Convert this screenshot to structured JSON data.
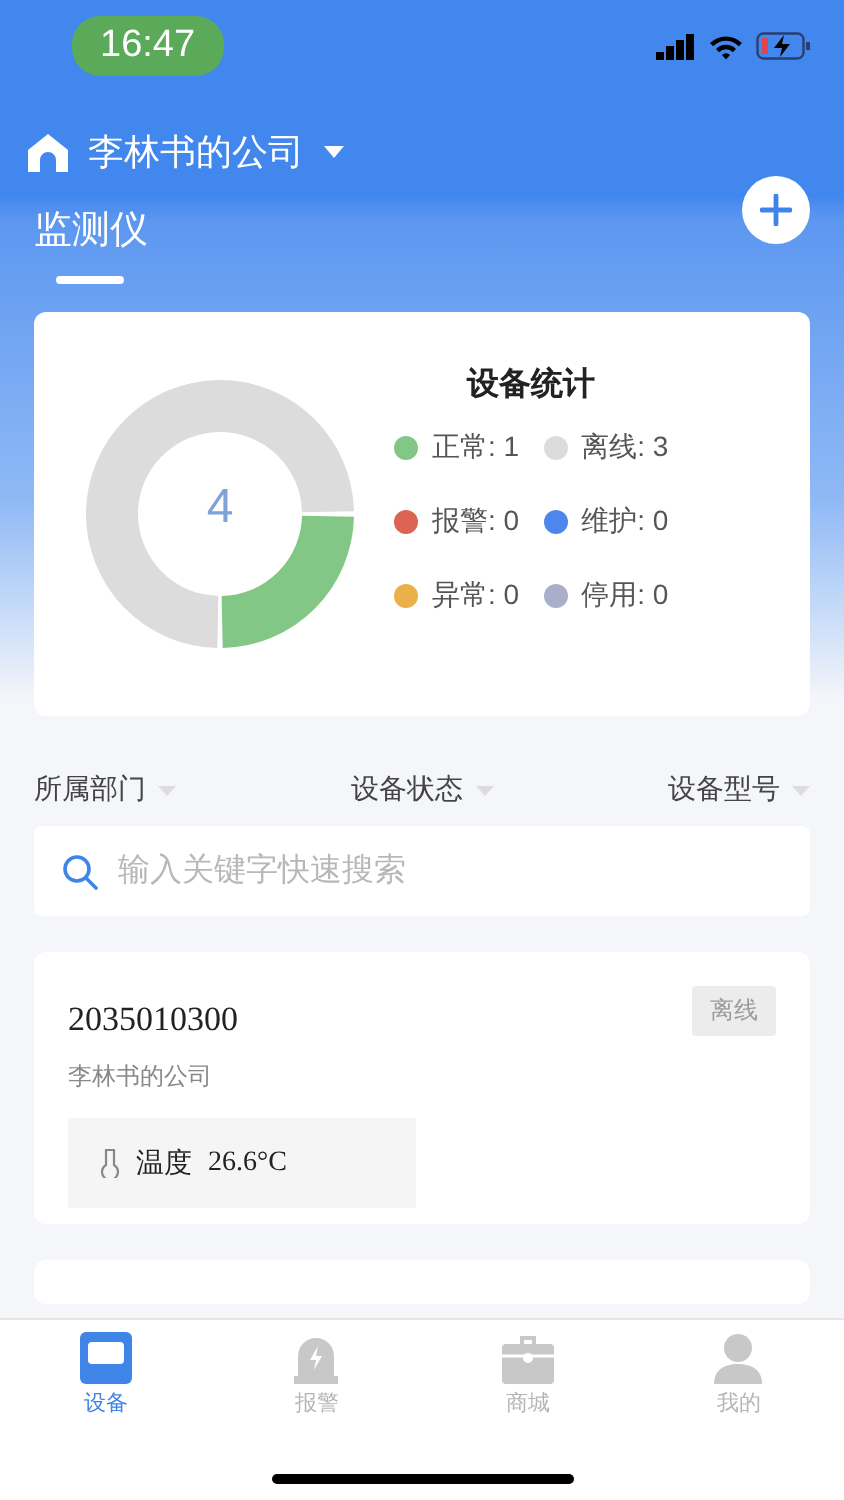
{
  "status_bar": {
    "time": "16:47"
  },
  "header": {
    "company": "李林书的公司"
  },
  "page_title": "监测仪",
  "stats": {
    "title": "设备统计",
    "total": "4",
    "legend": [
      {
        "label": "正常: 1",
        "color": "#82c785"
      },
      {
        "label": "离线: 3",
        "color": "#dcdcdc"
      },
      {
        "label": "报警: 0",
        "color": "#dc6455"
      },
      {
        "label": "维护: 0",
        "color": "#4f86ec"
      },
      {
        "label": "异常: 0",
        "color": "#ecb04a"
      },
      {
        "label": "停用: 0",
        "color": "#a9afca"
      }
    ]
  },
  "filters": [
    "所属部门",
    "设备状态",
    "设备型号"
  ],
  "search": {
    "placeholder": "输入关键字快速搜索"
  },
  "devices": [
    {
      "id": "2035010300",
      "company": "李林书的公司",
      "status": "离线",
      "reading_label": "温度",
      "reading_value": "26.6°C"
    }
  ],
  "tab_bar": [
    {
      "label": "设备",
      "kind": "device",
      "selected": true
    },
    {
      "label": "报警",
      "kind": "alarm",
      "selected": false
    },
    {
      "label": "商城",
      "kind": "shop",
      "selected": false
    },
    {
      "label": "我的",
      "kind": "profile",
      "selected": false
    }
  ]
}
